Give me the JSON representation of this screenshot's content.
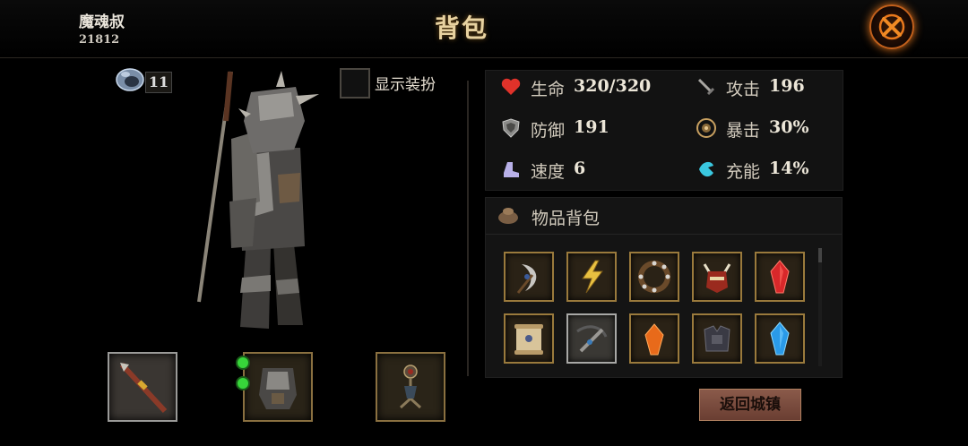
{
  "header": {
    "player_name": "魔魂叔",
    "player_id": "21812",
    "title": "背包"
  },
  "currency": {
    "icon": "soul-stone-icon",
    "value": "11"
  },
  "outfit_toggle": {
    "label": "显示装扮",
    "checked": false
  },
  "stats": [
    {
      "key": "hp",
      "icon": "heart-icon",
      "label": "生命",
      "value": "320/320",
      "color": "#e0322a"
    },
    {
      "key": "atk",
      "icon": "sword-icon",
      "label": "攻击",
      "value": "196",
      "color": "#9a9a9a"
    },
    {
      "key": "def",
      "icon": "shield-icon",
      "label": "防御",
      "value": "191",
      "color": "#9a9a9a"
    },
    {
      "key": "crit",
      "icon": "crit-icon",
      "label": "暴击",
      "value": "30%",
      "color": "#c8a060"
    },
    {
      "key": "spd",
      "icon": "boot-icon",
      "label": "速度",
      "value": "6",
      "color": "#b8b0e8"
    },
    {
      "key": "charge",
      "icon": "charge-icon",
      "label": "充能",
      "value": "14%",
      "color": "#3ac8e0"
    }
  ],
  "bag": {
    "title": "物品背包",
    "items": [
      {
        "name": "crescent-axe-item",
        "frame": "gold"
      },
      {
        "name": "lightning-rune-item",
        "frame": "gold"
      },
      {
        "name": "spiked-collar-item",
        "frame": "gold"
      },
      {
        "name": "horned-helmet-item",
        "frame": "gold"
      },
      {
        "name": "red-crystal-item",
        "frame": "gold"
      },
      {
        "name": "scroll-item",
        "frame": "gold"
      },
      {
        "name": "crossbow-item",
        "frame": "grey"
      },
      {
        "name": "orange-crystal-item",
        "frame": "gold"
      },
      {
        "name": "dark-armor-item",
        "frame": "gold"
      },
      {
        "name": "blue-crystal-item",
        "frame": "gold"
      }
    ]
  },
  "equipment": [
    {
      "name": "weapon-slot",
      "icon": "spear-icon",
      "frame": "grey"
    },
    {
      "name": "armor-slot",
      "icon": "armor-icon",
      "frame": "gold",
      "gems": 2
    },
    {
      "name": "amulet-slot",
      "icon": "amulet-icon",
      "frame": "gold"
    }
  ],
  "return_button": "返回城镇"
}
